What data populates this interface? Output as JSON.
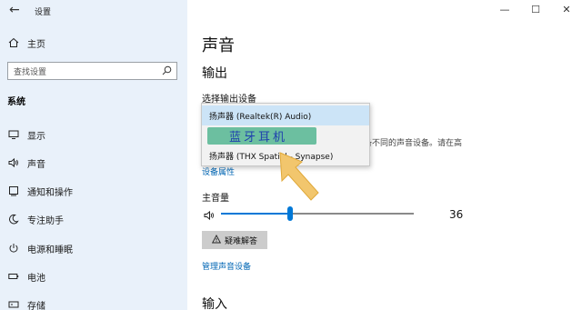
{
  "window": {
    "title": "设置",
    "controls": {
      "minimize": "—",
      "maximize": "☐",
      "close": "✕"
    }
  },
  "sidebar": {
    "home_label": "主页",
    "search_placeholder": "查找设置",
    "group_heading": "系统",
    "items": [
      {
        "label": "显示",
        "icon": "display-icon"
      },
      {
        "label": "声音",
        "icon": "speaker-icon"
      },
      {
        "label": "通知和操作",
        "icon": "notification-icon"
      },
      {
        "label": "专注助手",
        "icon": "moon-icon"
      },
      {
        "label": "电源和睡眠",
        "icon": "power-icon"
      },
      {
        "label": "电池",
        "icon": "battery-icon"
      },
      {
        "label": "存储",
        "icon": "storage-icon"
      }
    ]
  },
  "main": {
    "page_title": "声音",
    "output_heading": "输出",
    "select_device_label": "选择输出设备",
    "device_hint_text": "备不同的声音设备。请在高",
    "device_properties_link": "设备属性",
    "master_volume_label": "主音量",
    "volume_value": "36",
    "volume_fraction": 0.36,
    "troubleshoot_label": "疑难解答",
    "manage_devices_link": "管理声音设备",
    "input_heading": "输入"
  },
  "dropdown": {
    "options": [
      "扬声器 (Realtek(R) Audio)",
      "蓝牙耳机",
      "扬声器 (THX Spatial - Synapse)"
    ],
    "selected_index": 0,
    "highlight_color": "#6cbfa0"
  },
  "colors": {
    "accent": "#0078d7",
    "sidebar_bg": "#e9f1fa",
    "link": "#0066b4",
    "arrow": "#f2c66d"
  }
}
